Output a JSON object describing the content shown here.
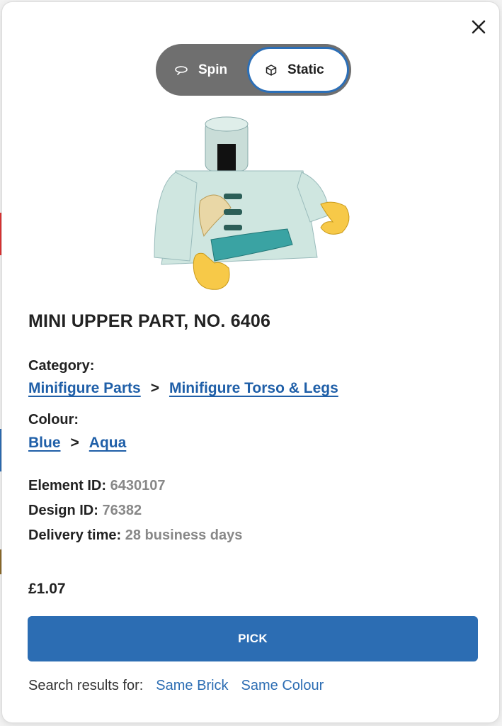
{
  "toggle": {
    "spin_label": "Spin",
    "static_label": "Static",
    "selected": "Static"
  },
  "product": {
    "title": "MINI UPPER PART, NO. 6406",
    "category_label": "Category:",
    "category": [
      "Minifigure Parts",
      "Minifigure Torso & Legs"
    ],
    "colour_label": "Colour:",
    "colour": [
      "Blue",
      "Aqua"
    ],
    "element_id_label": "Element ID:",
    "element_id": "6430107",
    "design_id_label": "Design ID:",
    "design_id": "76382",
    "delivery_label": "Delivery time:",
    "delivery": "28 business days",
    "price": "£1.07"
  },
  "actions": {
    "pick_label": "PICK"
  },
  "search": {
    "label": "Search results for:",
    "links": [
      "Same Brick",
      "Same Colour"
    ]
  },
  "icons": {
    "close": "close-icon",
    "spin": "spin-icon",
    "static": "cube-icon"
  },
  "colors": {
    "accent": "#2c6db3",
    "toggle_bg": "#6f6f6f",
    "muted": "#888888"
  }
}
